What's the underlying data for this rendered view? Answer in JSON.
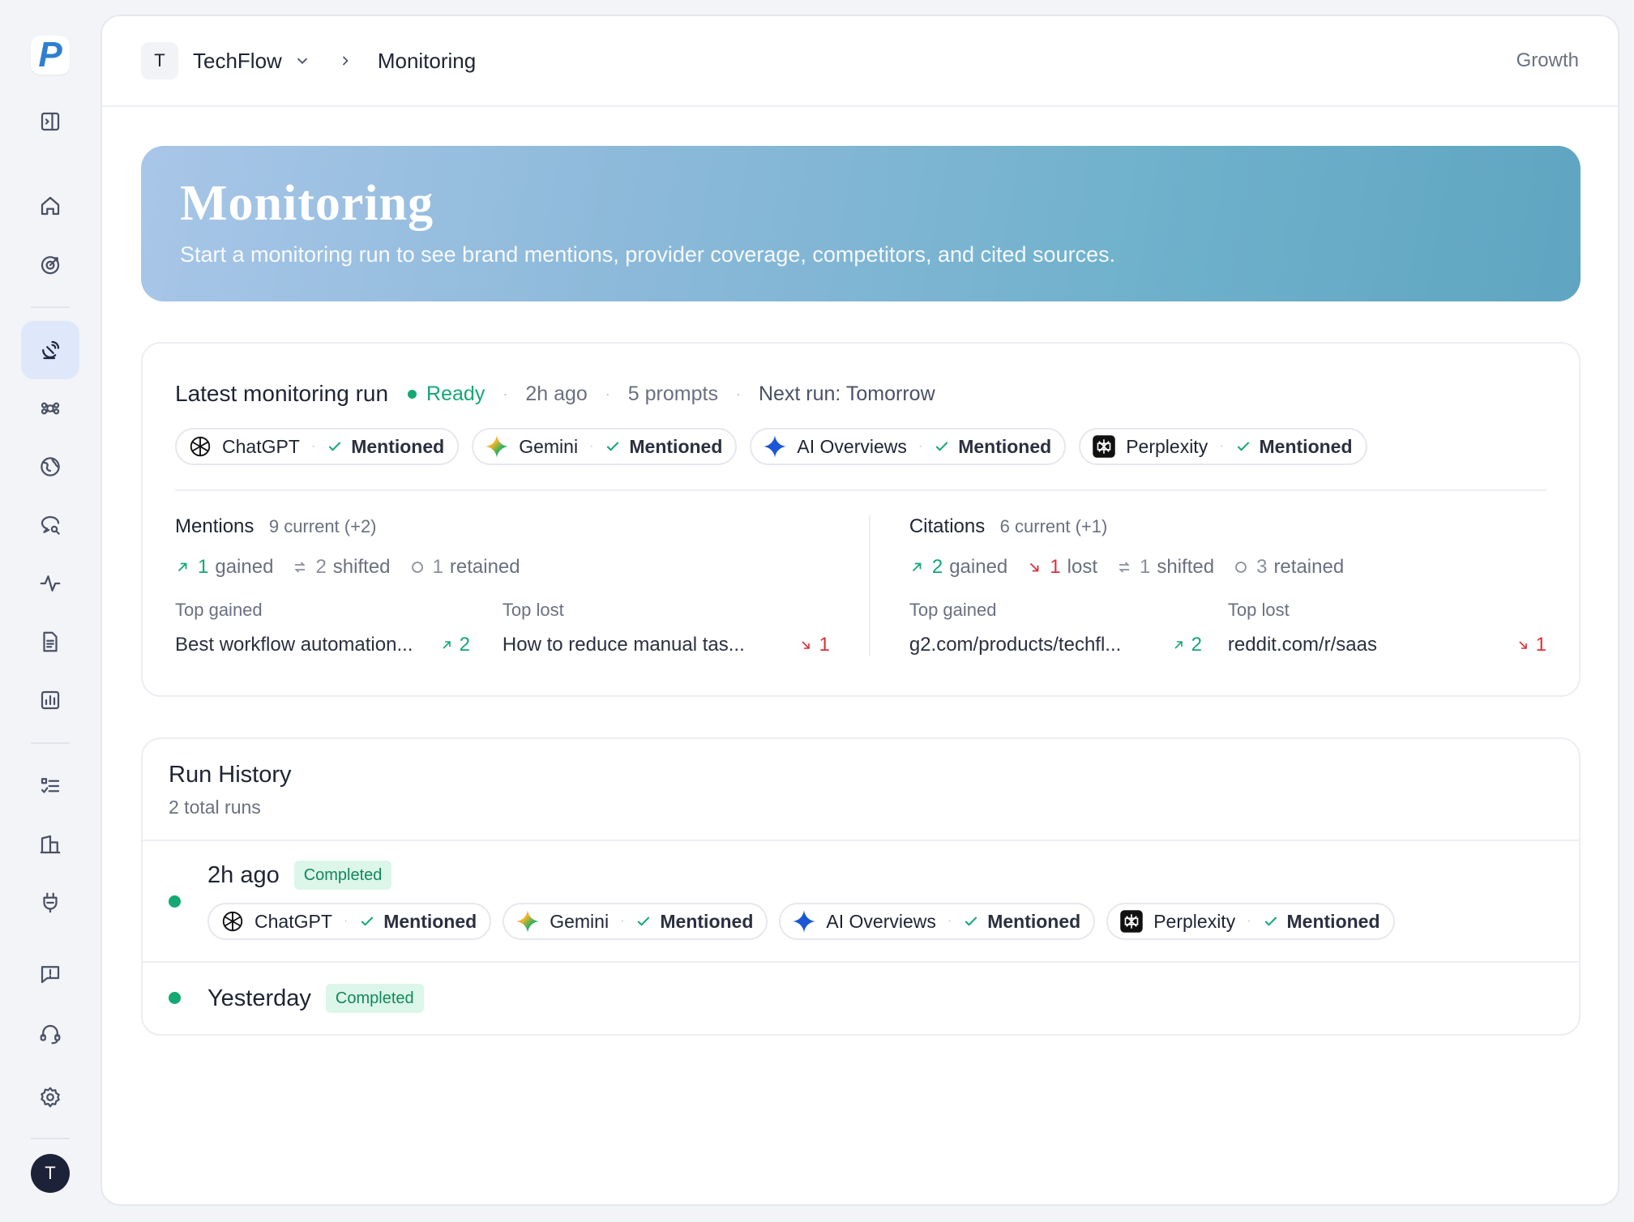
{
  "sidebar": {
    "logo": "P",
    "avatar": "T",
    "items": [
      {
        "name": "toggle-sidebar-icon"
      },
      {
        "name": "home-icon"
      },
      {
        "name": "target-icon"
      },
      {
        "name": "monitoring-icon",
        "active": true
      },
      {
        "name": "brain-icon"
      },
      {
        "name": "globe-icon"
      },
      {
        "name": "search-chat-icon"
      },
      {
        "name": "activity-icon"
      },
      {
        "name": "document-icon"
      },
      {
        "name": "bar-chart-icon"
      },
      {
        "name": "checklist-icon"
      },
      {
        "name": "building-icon"
      },
      {
        "name": "plug-icon"
      },
      {
        "name": "feedback-icon"
      },
      {
        "name": "support-headset-icon"
      },
      {
        "name": "settings-icon"
      }
    ]
  },
  "topbar": {
    "workspace_initial": "T",
    "workspace_name": "TechFlow",
    "current_page": "Monitoring",
    "plan": "Growth"
  },
  "hero": {
    "title": "Monitoring",
    "subtitle": "Start a monitoring run to see brand mentions, provider coverage, competitors, and cited sources."
  },
  "latest_run": {
    "title": "Latest monitoring run",
    "status": "Ready",
    "time": "2h ago",
    "prompts": "5 prompts",
    "next_run": "Next run: Tomorrow",
    "providers": [
      {
        "name": "ChatGPT",
        "status": "Mentioned"
      },
      {
        "name": "Gemini",
        "status": "Mentioned"
      },
      {
        "name": "AI Overviews",
        "status": "Mentioned"
      },
      {
        "name": "Perplexity",
        "status": "Mentioned"
      }
    ],
    "mentions": {
      "title": "Mentions",
      "current": "9 current (+2)",
      "gained_num": "1",
      "gained_label": "gained",
      "shifted_num": "2",
      "shifted_label": "shifted",
      "retained_num": "1",
      "retained_label": "retained",
      "top_gained_label": "Top gained",
      "top_gained_text": "Best workflow automation...",
      "top_gained_value": "2",
      "top_lost_label": "Top lost",
      "top_lost_text": "How to reduce manual tas...",
      "top_lost_value": "1"
    },
    "citations": {
      "title": "Citations",
      "current": "6 current (+1)",
      "gained_num": "2",
      "gained_label": "gained",
      "lost_num": "1",
      "lost_label": "lost",
      "shifted_num": "1",
      "shifted_label": "shifted",
      "retained_num": "3",
      "retained_label": "retained",
      "top_gained_label": "Top gained",
      "top_gained_text": "g2.com/products/techfl...",
      "top_gained_value": "2",
      "top_lost_label": "Top lost",
      "top_lost_text": "reddit.com/r/saas",
      "top_lost_value": "1"
    }
  },
  "history": {
    "title": "Run History",
    "subtitle": "2 total runs",
    "runs": [
      {
        "when": "2h ago",
        "status": "Completed",
        "providers": [
          {
            "name": "ChatGPT",
            "status": "Mentioned"
          },
          {
            "name": "Gemini",
            "status": "Mentioned"
          },
          {
            "name": "AI Overviews",
            "status": "Mentioned"
          },
          {
            "name": "Perplexity",
            "status": "Mentioned"
          }
        ]
      },
      {
        "when": "Yesterday",
        "status": "Completed"
      }
    ]
  },
  "colors": {
    "accent_green": "#14a873",
    "loss_red": "#d8323a",
    "hero_start": "#a8c6e8",
    "hero_end": "#5fa5c1",
    "active_nav_bg": "#dfe8fa"
  }
}
